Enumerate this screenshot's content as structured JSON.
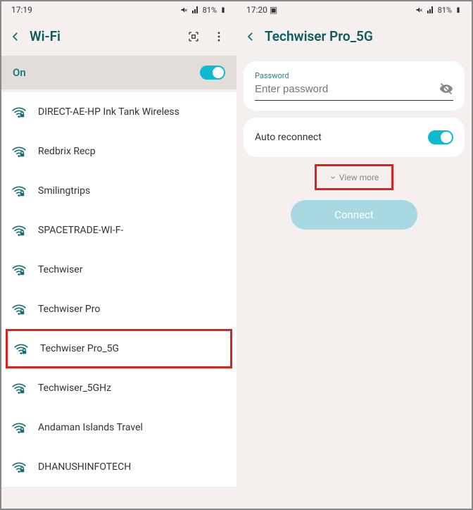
{
  "left": {
    "time": "17:19",
    "battery": "81%",
    "title": "Wi-Fi",
    "on_label": "On",
    "networks": [
      {
        "name": "DIRECT-AE-HP Ink Tank Wireless",
        "locked": true,
        "highlighted": false
      },
      {
        "name": "Redbrix Recp",
        "locked": true,
        "highlighted": false
      },
      {
        "name": "Smilingtrips",
        "locked": true,
        "highlighted": false
      },
      {
        "name": "SPACETRADE-WI-F-",
        "locked": true,
        "highlighted": false
      },
      {
        "name": "Techwiser",
        "locked": true,
        "highlighted": false
      },
      {
        "name": "Techwiser Pro",
        "locked": true,
        "highlighted": false
      },
      {
        "name": "Techwiser Pro_5G",
        "locked": true,
        "highlighted": true
      },
      {
        "name": "Techwiser_5GHz",
        "locked": true,
        "highlighted": false
      },
      {
        "name": "Andaman Islands Travel",
        "locked": true,
        "highlighted": false
      },
      {
        "name": "DHANUSHINFOTECH",
        "locked": true,
        "highlighted": false
      }
    ]
  },
  "right": {
    "time": "17:20",
    "battery": "81%",
    "title": "Techwiser Pro_5G",
    "password_label": "Password",
    "password_placeholder": "Enter password",
    "auto_reconnect_label": "Auto reconnect",
    "view_more_label": "View more",
    "connect_label": "Connect"
  }
}
